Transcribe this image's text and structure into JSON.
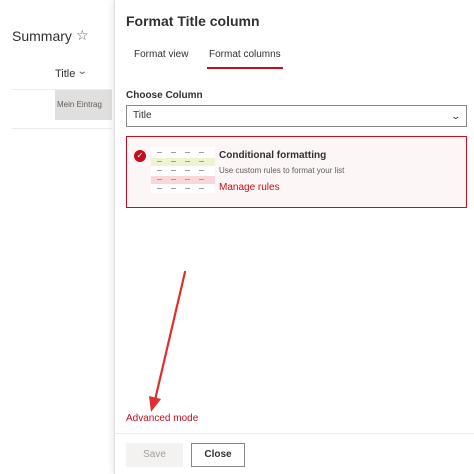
{
  "list": {
    "title": "Summary",
    "star_icon": "star-icon",
    "column_header": "Title",
    "cell_value": "Mein Eintrag"
  },
  "panel": {
    "title": "Format Title column",
    "tabs": [
      {
        "label": "Format view",
        "selected": false
      },
      {
        "label": "Format columns",
        "selected": true
      }
    ],
    "choose_column_label": "Choose Column",
    "selected_column": "Title",
    "card": {
      "title": "Conditional formatting",
      "description": "Use custom rules to format your list",
      "link": "Manage rules",
      "selected": true
    },
    "advanced_mode": "Advanced mode",
    "save_label": "Save",
    "close_label": "Close"
  },
  "colors": {
    "accent": "#c50f1f",
    "annotation_arrow": "#e02d2d"
  }
}
